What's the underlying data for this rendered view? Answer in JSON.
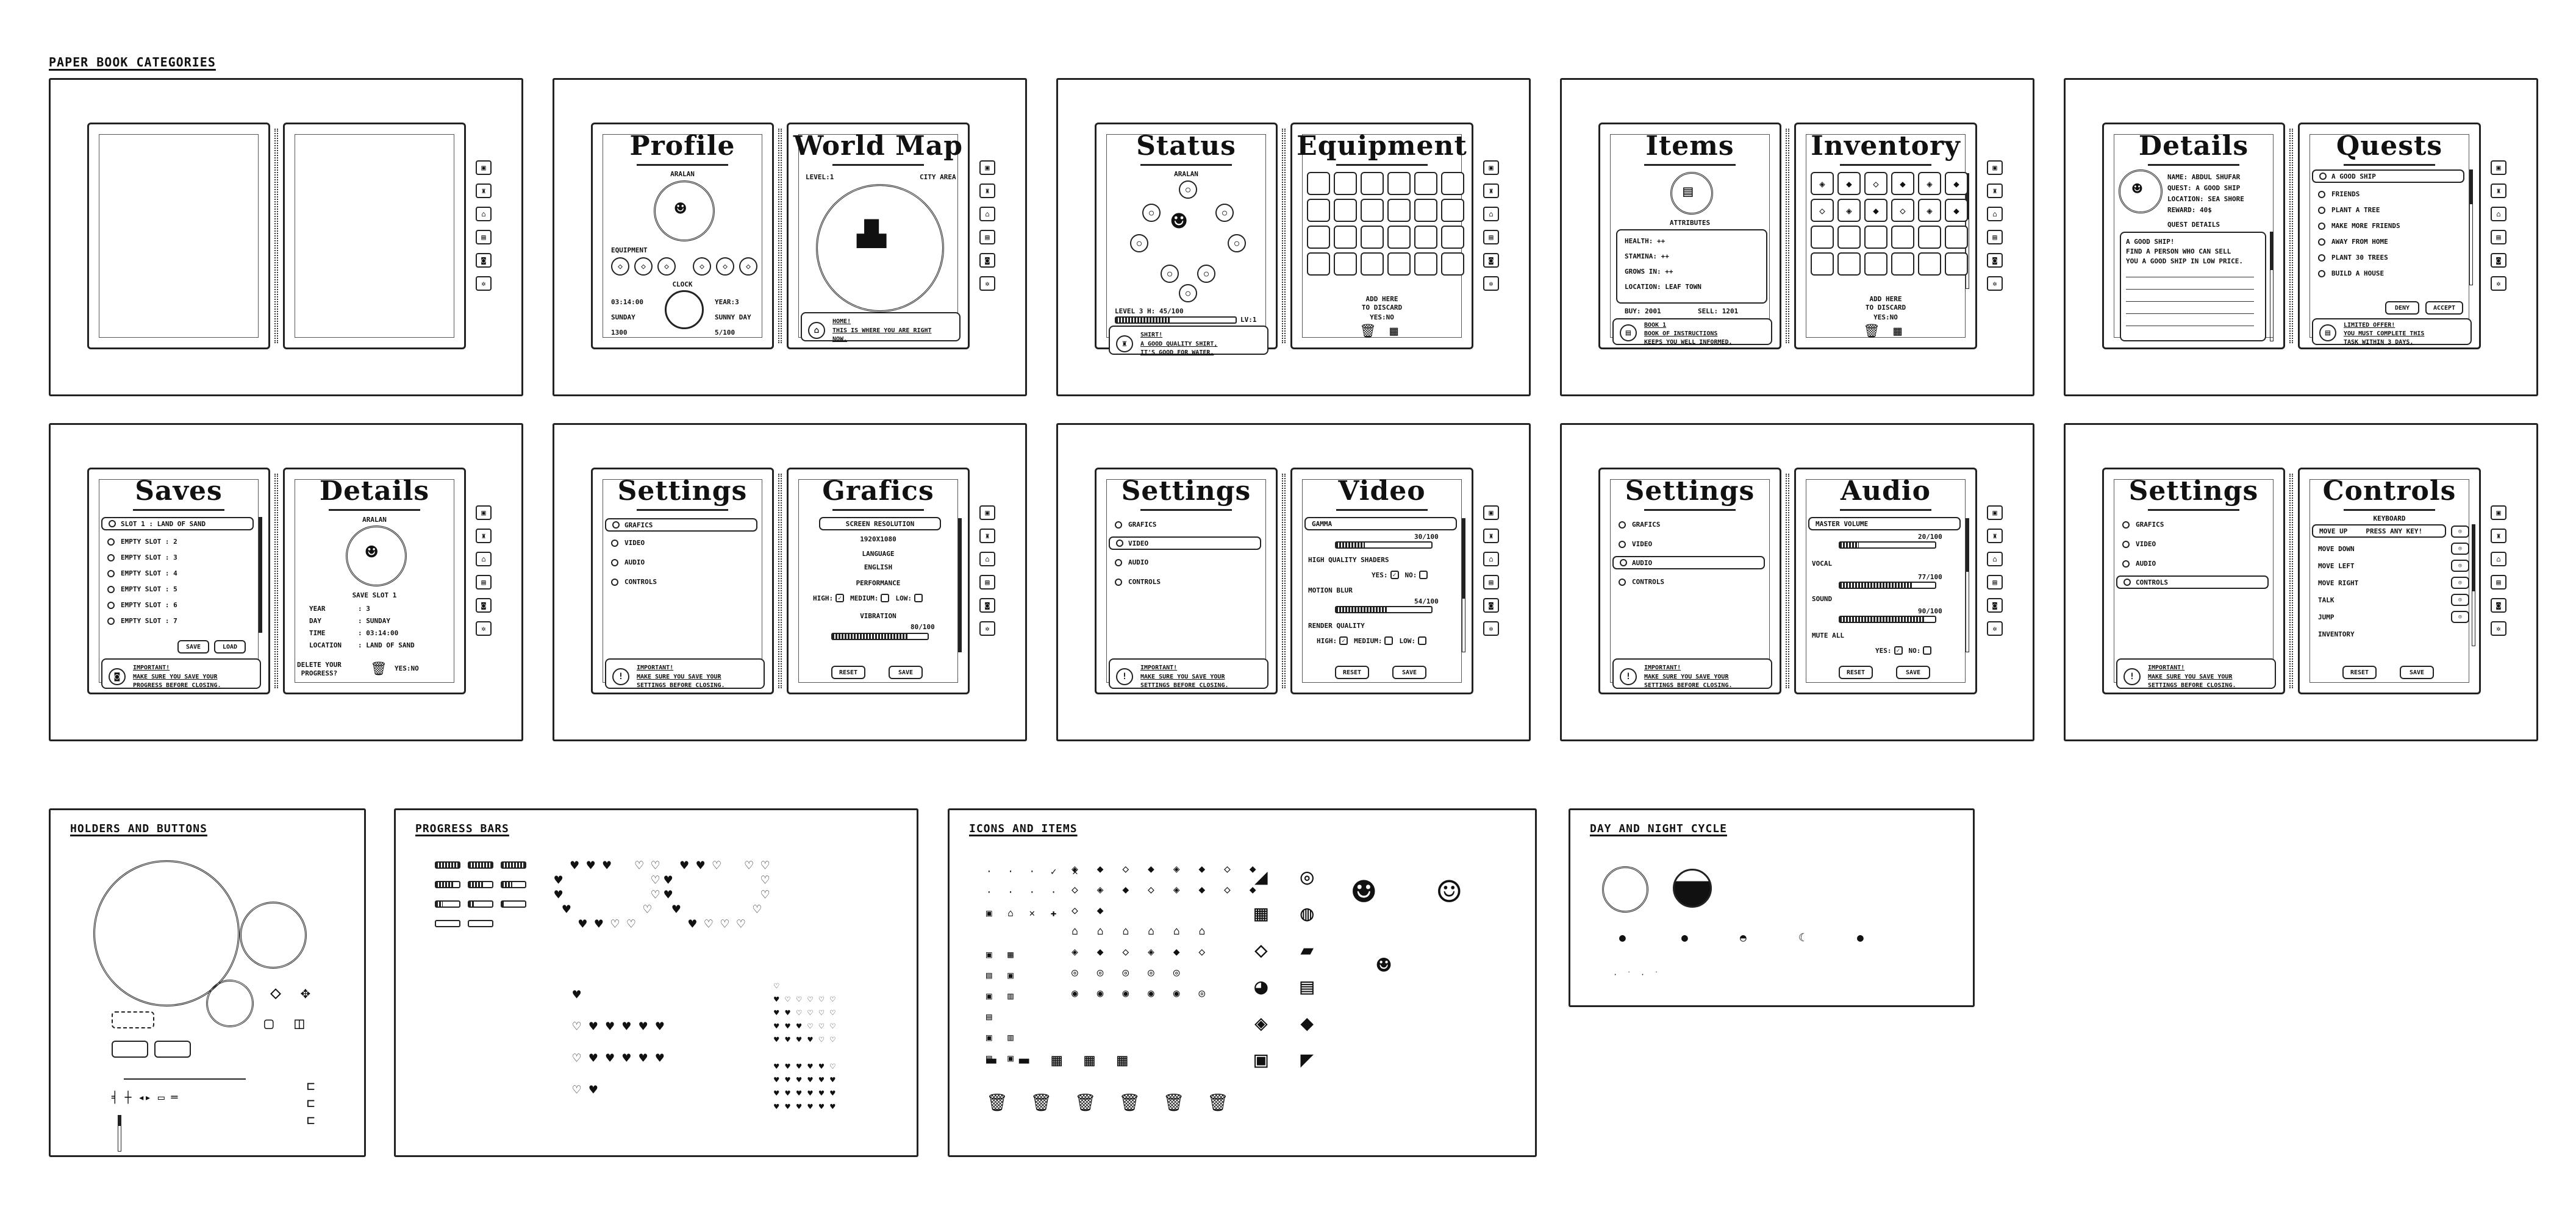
{
  "sections": {
    "paper": "PAPER BOOK CATEGORIES",
    "holders": "HOLDERS AND BUTTONS",
    "progress": "PROGRESS BARS",
    "icons": "ICONS AND ITEMS",
    "daynight": "DAY AND NIGHT CYCLE"
  },
  "profile": {
    "title": "Profile",
    "name": "ARALAN",
    "equipment": "EQUIPMENT",
    "clock": "CLOCK",
    "time": "03:14:00",
    "day": "SUNDAY",
    "year": "YEAR:3",
    "weather": "SUNNY DAY",
    "money": "1300",
    "hp": "5/100"
  },
  "worldmap": {
    "title": "World Map",
    "level": "LEVEL:1",
    "area": "CITY AREA",
    "note_title": "HOME!",
    "note_body": "THIS IS WHERE YOU ARE RIGHT\nNOW."
  },
  "status": {
    "title": "Status",
    "name": "ARALAN",
    "level": "LEVEL 3 H: 45/100",
    "lv": "LV:1",
    "note_title": "SHIRT!",
    "note_body": "A GOOD QUALITY SHIRT,\nIT'S GOOD FOR WATER."
  },
  "equipment": {
    "title": "Equipment",
    "hint": "ADD HERE\nTO DISCARD",
    "yesno": "YES:NO"
  },
  "items": {
    "title": "Items",
    "attributes": "ATTRIBUTES",
    "stats": [
      "HEALTH: ++",
      "STAMINA: ++",
      "GROWS IN: ++",
      "LOCATION: LEAF TOWN"
    ],
    "buy": "BUY: 2001",
    "sell": "SELL: 1201",
    "note_title": "BOOK 1",
    "note_body": "BOOK OF INSTRUCTIONS\nKEEPS YOU WELL INFORMED."
  },
  "inventory": {
    "title": "Inventory",
    "hint": "ADD HERE\nTO DISCARD",
    "yesno": "YES:NO"
  },
  "details": {
    "title": "Details",
    "name": "NAME: ABDUL SHUFAR",
    "quest": "QUEST: A GOOD SHIP",
    "location": "LOCATION: SEA SHORE",
    "reward": "REWARD: 40$",
    "subhead": "QUEST DETAILS",
    "lines": [
      "A GOOD SHIP!",
      "FIND A PERSON WHO CAN SELL",
      "YOU A GOOD SHIP IN LOW PRICE."
    ]
  },
  "quests": {
    "title": "Quests",
    "items": [
      "A GOOD SHIP",
      "FRIENDS",
      "PLANT A TREE",
      "MAKE MORE FRIENDS",
      "AWAY FROM HOME",
      "PLANT 30 TREES",
      "BUILD A HOUSE"
    ],
    "deny": "DENY",
    "accept": "ACCEPT",
    "note_title": "LIMITED OFFER!",
    "note_body": "YOU MUST COMPLETE THIS\nTASK WITHIN 3 DAYS."
  },
  "saves": {
    "title": "Saves",
    "slots": [
      "SLOT 1 : LAND OF SAND",
      "EMPTY SLOT : 2",
      "EMPTY SLOT : 3",
      "EMPTY SLOT : 4",
      "EMPTY SLOT : 5",
      "EMPTY SLOT : 6",
      "EMPTY SLOT : 7"
    ],
    "save": "SAVE",
    "load": "LOAD",
    "note_title": "IMPORTANT!",
    "note_body": "MAKE SURE YOU SAVE YOUR\nPROGRESS BEFORE CLOSING."
  },
  "savedetails": {
    "title": "Details",
    "name": "ARALAN",
    "slot": "SAVE SLOT 1",
    "rows": [
      [
        "YEAR",
        ": 3"
      ],
      [
        "DAY",
        ": SUNDAY"
      ],
      [
        "TIME",
        ": 03:14:00"
      ],
      [
        "LOCATION",
        ": LAND OF SAND"
      ]
    ],
    "delete": "DELETE YOUR\nPROGRESS?",
    "yesno": "YES:NO"
  },
  "settings": {
    "title": "Settings",
    "menu": [
      "GRAFICS",
      "VIDEO",
      "AUDIO",
      "CONTROLS"
    ],
    "note_title": "IMPORTANT!",
    "note_body": "MAKE SURE YOU SAVE YOUR\nSETTINGS BEFORE CLOSING."
  },
  "grafics": {
    "title": "Grafics",
    "resolution_label": "SCREEN RESOLUTION",
    "resolution": "1920X1080",
    "language_label": "LANGUAGE",
    "language": "ENGLISH",
    "performance": "PERFORMANCE",
    "high": "HIGH:",
    "medium": "MEDIUM:",
    "low": "LOW:",
    "vibration": "VIBRATION",
    "vib_value": "80/100",
    "vib_level": 0.8,
    "reset": "RESET",
    "save": "SAVE"
  },
  "video": {
    "title": "Video",
    "gamma": "GAMMA",
    "gamma_val": "30/100",
    "gamma_level": 0.3,
    "shaders": "HIGH QUALITY SHADERS",
    "yes": "YES:",
    "no": "NO:",
    "motion": "MOTION BLUR",
    "motion_val": "54/100",
    "motion_level": 0.54,
    "render": "RENDER QUALITY",
    "high": "HIGH:",
    "medium": "MEDIUM:",
    "low": "LOW:",
    "reset": "RESET",
    "save": "SAVE"
  },
  "audio": {
    "title": "Audio",
    "master": "MASTER VOLUME",
    "master_val": "20/100",
    "master_level": 0.2,
    "vocal": "VOCAL",
    "vocal_val": "77/100",
    "vocal_level": 0.77,
    "sound": "SOUND",
    "sound_val": "90/100",
    "sound_level": 0.9,
    "mute": "MUTE ALL",
    "yes": "YES:",
    "no": "NO:",
    "reset": "RESET",
    "save": "SAVE"
  },
  "controls": {
    "title": "Controls",
    "keyboard": "KEYBOARD",
    "press": "PRESS ANY KEY!",
    "rows": [
      "MOVE UP",
      "MOVE DOWN",
      "MOVE LEFT",
      "MOVE RIGHT",
      "TALK",
      "JUMP",
      "INVENTORY"
    ],
    "reset": "RESET",
    "save": "SAVE"
  },
  "icons": {
    "tab_icons": [
      "map-icon",
      "shirt-icon",
      "bag-icon",
      "scroll-icon",
      "disk-icon",
      "gear-icon"
    ]
  }
}
